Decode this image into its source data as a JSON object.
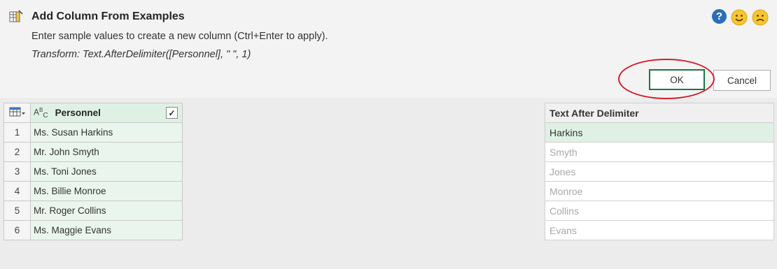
{
  "dialog": {
    "title": "Add Column From Examples",
    "subtitle": "Enter sample values to create a new column (Ctrl+Enter to apply).",
    "transform": "Transform: Text.AfterDelimiter([Personnel], \" \", 1)",
    "help_icon_label": "?",
    "ok_label": "OK",
    "cancel_label": "Cancel",
    "highlight_color": "#d0202b"
  },
  "source_table": {
    "column_type_glyph": "ABC",
    "column_header": "Personnel",
    "column_checked": true,
    "rows": [
      {
        "num": "1",
        "value": "Ms. Susan Harkins"
      },
      {
        "num": "2",
        "value": "Mr. John Smyth"
      },
      {
        "num": "3",
        "value": "Ms. Toni Jones"
      },
      {
        "num": "4",
        "value": "Ms. Billie Monroe"
      },
      {
        "num": "5",
        "value": "Mr. Roger Collins"
      },
      {
        "num": "6",
        "value": "Ms. Maggie Evans"
      }
    ]
  },
  "new_column": {
    "header": "Text After Delimiter",
    "values": [
      "Harkins",
      "Smyth",
      "Jones",
      "Monroe",
      "Collins",
      "Evans"
    ]
  },
  "icons": {
    "title": "add-column-icon",
    "help": "help-icon",
    "smile": "smile-icon",
    "frown": "frown-icon",
    "table_menu": "table-menu-icon",
    "check": "checkbox-icon"
  }
}
